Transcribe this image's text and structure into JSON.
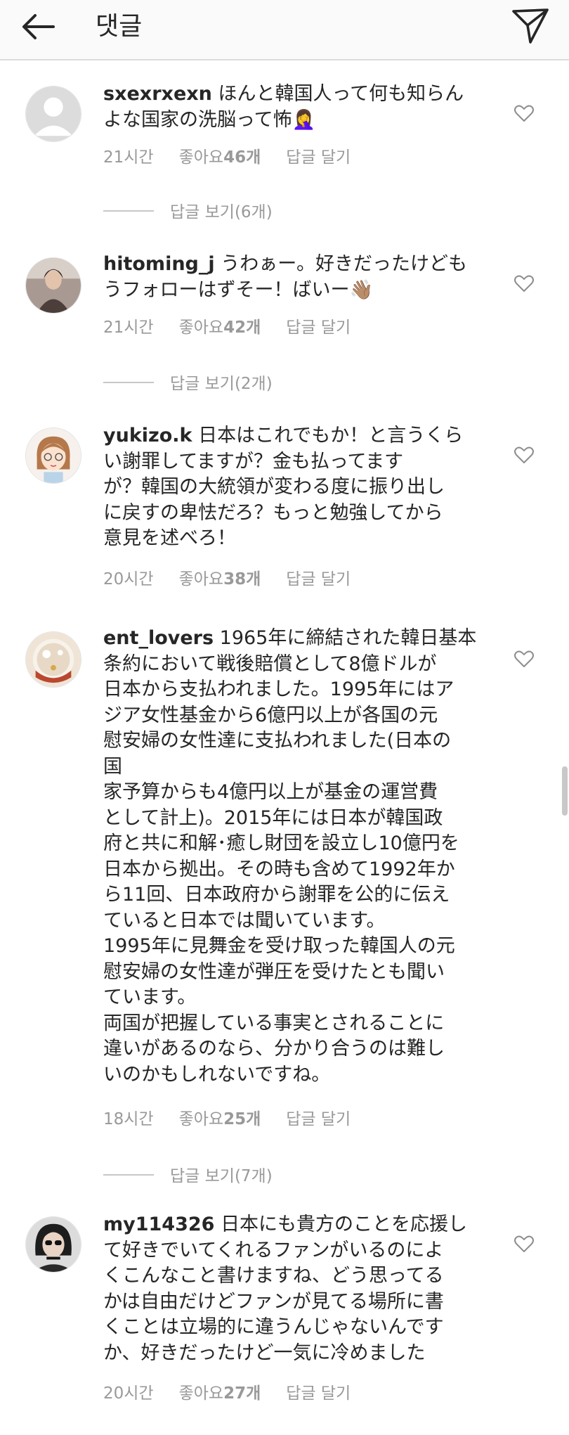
{
  "header": {
    "title": "댓글"
  },
  "comments": [
    {
      "username": "sxexrxexn",
      "text": "ほんと韓国人って何も知らん\nよな国家の洗脳って怖",
      "emoji": "🤦‍♀️",
      "time": "21시간",
      "likes_prefix": "좋아요 ",
      "likes_count": "46개",
      "reply_label": "답글 달기",
      "view_replies": "답글 보기(6개)"
    },
    {
      "username": "hitoming_j",
      "text": "うわぁー。好きだったけども\nうフォローはずそー！ばいー",
      "emoji": "👋🏽",
      "time": "21시간",
      "likes_prefix": "좋아요 ",
      "likes_count": "42개",
      "reply_label": "답글 달기",
      "view_replies": "답글 보기(2개)"
    },
    {
      "username": "yukizo.k",
      "text": "日本はこれでもか！と言うくら\nい謝罪してますが？金も払ってます\nが？韓国の大統領が変わる度に振り出し\nに戻すの卑怯だろ？もっと勉強してから\n意見を述べろ！",
      "emoji": "",
      "time": "20시간",
      "likes_prefix": "좋아요 ",
      "likes_count": "38개",
      "reply_label": "답글 달기",
      "view_replies": ""
    },
    {
      "username": "ent_lovers",
      "text": "1965年に締結された韓日基本\n条約において戦後賠償として8億ドルが\n日本から支払われました。1995年にはア\nジア女性基金から6億円以上が各国の元\n慰安婦の女性達に支払われました(日本の\n国\n家予算からも4億円以上が基金の運営費\nとして計上)。2015年には日本が韓国政\n府と共に和解･癒し財団を設立し10億円を\n日本から拠出。その時も含めて1992年か\nら11回、日本政府から謝罪を公的に伝え\nていると日本では聞いています。\n1995年に見舞金を受け取った韓国人の元\n慰安婦の女性達が弾圧を受けたとも聞い\nています。\n両国が把握している事実とされることに\n違いがあるのなら、分かり合うのは難し\nいのかもしれないですね。",
      "emoji": "",
      "time": "18시간",
      "likes_prefix": "좋아요 ",
      "likes_count": "25개",
      "reply_label": "답글 달기",
      "view_replies": "답글 보기(7개)"
    },
    {
      "username": "my114326",
      "text": "日本にも貴方のことを応援し\nて好きでいてくれるファンがいるのによ\nくこんなこと書けますね、どう思ってる\nかは自由だけどファンが見てる場所に書\nくことは立場的に違うんじゃないんです\nか、好きだったけど一気に冷めました",
      "emoji": "",
      "time": "20시간",
      "likes_prefix": "좋아요 ",
      "likes_count": "27개",
      "reply_label": "답글 달기",
      "view_replies": ""
    }
  ]
}
